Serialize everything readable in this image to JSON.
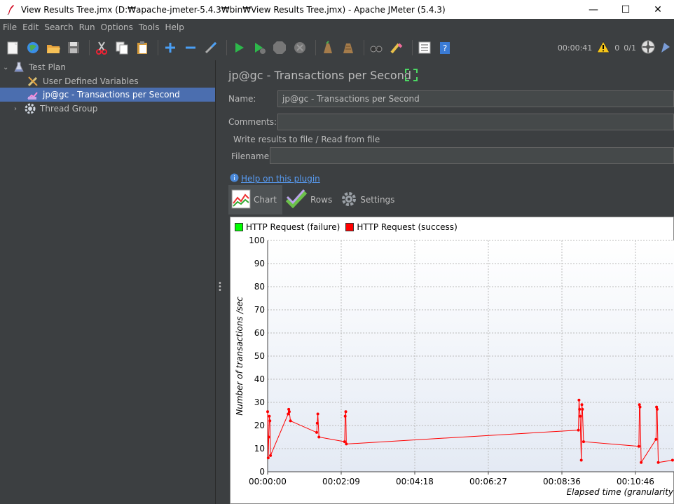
{
  "window": {
    "title": "View Results Tree.jmx (D:₩apache-jmeter-5.4.3₩bin₩View Results Tree.jmx) - Apache JMeter (5.4.3)",
    "minimize": "—",
    "maximize": "☐",
    "close": "✕"
  },
  "menu": [
    "File",
    "Edit",
    "Search",
    "Run",
    "Options",
    "Tools",
    "Help"
  ],
  "toolbar": {
    "icons": [
      "new-icon",
      "templates-icon",
      "open-icon",
      "save-icon",
      "cut-icon",
      "copy-icon",
      "paste-icon",
      "expand-icon",
      "collapse-icon",
      "toggle-icon",
      "start-icon",
      "start-no-pauses-icon",
      "stop-icon",
      "shutdown-icon",
      "clear-icon",
      "clear-all-icon",
      "search-icon",
      "reset-search-icon",
      "function-helper-icon",
      "help-icon"
    ],
    "elapsed": "00:00:41",
    "warnings": "0",
    "threads": "0/1"
  },
  "tree": {
    "items": [
      {
        "label": "Test Plan",
        "icon": "flask-icon"
      },
      {
        "label": "User Defined Variables",
        "icon": "wrench-icon"
      },
      {
        "label": "jp@gc - Transactions per Second",
        "icon": "graph-icon"
      },
      {
        "label": "Thread Group",
        "icon": "gear-icon"
      }
    ]
  },
  "panel": {
    "title": "jp@gc - Transactions per Second",
    "name_label": "Name:",
    "name_value": "jp@gc - Transactions per Second",
    "comments_label": "Comments:",
    "comments_value": "",
    "file_section": "Write results to file / Read from file",
    "filename_label": "Filename",
    "filename_value": "",
    "help_link": "Help on this plugin",
    "tabs": [
      "Chart",
      "Rows",
      "Settings"
    ]
  },
  "colors": {
    "failure": "#00ff00",
    "success": "#ff0000",
    "selection": "#4b6eaf",
    "link": "#589df6"
  },
  "chart_data": {
    "type": "line",
    "title": "",
    "xlabel": "Elapsed time (granularity",
    "ylabel": "Number of transactions /sec",
    "ylim": [
      0,
      100
    ],
    "y_ticks": [
      "0",
      "10",
      "20",
      "30",
      "40",
      "50",
      "60",
      "70",
      "80",
      "90",
      "100"
    ],
    "x_ticks": [
      "00:00:00",
      "00:02:09",
      "00:04:18",
      "00:06:27",
      "00:08:36",
      "00:10:46"
    ],
    "legend_position": "top",
    "grid": true,
    "series": [
      {
        "name": "HTTP Request (failure)",
        "color": "#00ff00",
        "values": []
      },
      {
        "name": "HTTP Request (success)",
        "color": "#ff0000",
        "points": [
          [
            0,
            26
          ],
          [
            1,
            6
          ],
          [
            2,
            15
          ],
          [
            3,
            24
          ],
          [
            4,
            22
          ],
          [
            5,
            7
          ],
          [
            36,
            25
          ],
          [
            37,
            27
          ],
          [
            38,
            26
          ],
          [
            40,
            22
          ],
          [
            86,
            17
          ],
          [
            87,
            21
          ],
          [
            88,
            25
          ],
          [
            90,
            15
          ],
          [
            135,
            13
          ],
          [
            136,
            24
          ],
          [
            137,
            26
          ],
          [
            138,
            12
          ],
          [
            545,
            18
          ],
          [
            546,
            31
          ],
          [
            547,
            27
          ],
          [
            548,
            24
          ],
          [
            550,
            5
          ],
          [
            551,
            29
          ],
          [
            552,
            27
          ],
          [
            554,
            13
          ],
          [
            651,
            11
          ],
          [
            652,
            29
          ],
          [
            653,
            28
          ],
          [
            655,
            4
          ],
          [
            681,
            14
          ],
          [
            682,
            28
          ],
          [
            683,
            27
          ],
          [
            685,
            4
          ],
          [
            710,
            5
          ]
        ]
      }
    ]
  }
}
